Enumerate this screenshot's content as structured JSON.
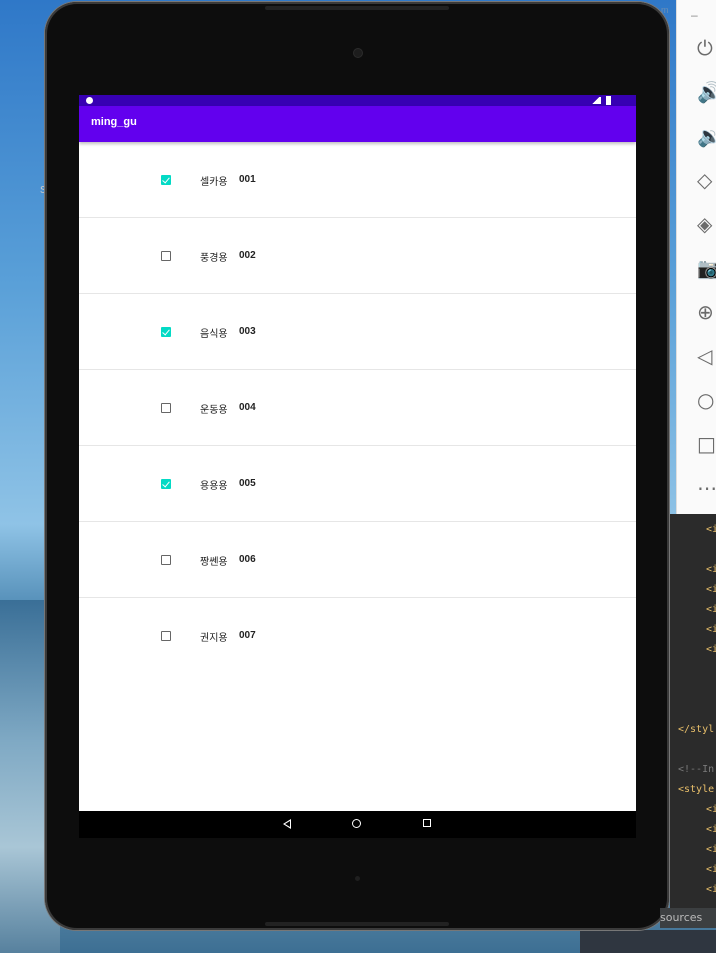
{
  "app": {
    "title": "ming_gu"
  },
  "items": [
    {
      "name": "셀카용",
      "number": "001",
      "checked": true
    },
    {
      "name": "풍경용",
      "number": "002",
      "checked": false
    },
    {
      "name": "음식용",
      "number": "003",
      "checked": true
    },
    {
      "name": "운동용",
      "number": "004",
      "checked": false
    },
    {
      "name": "용용용",
      "number": "005",
      "checked": true
    },
    {
      "name": "짱쎈용",
      "number": "006",
      "checked": false
    },
    {
      "name": "권지용",
      "number": "007",
      "checked": false
    }
  ],
  "emulator_toolbar": {
    "minimize_label": "–",
    "tools": [
      "power-icon",
      "volume-up-icon",
      "volume-down-icon",
      "rotate-left-icon",
      "rotate-right-icon",
      "camera-icon",
      "zoom-icon",
      "back-icon",
      "home-icon",
      "overview-icon",
      "more-icon"
    ]
  },
  "editor": {
    "lines": [
      "<i",
      "<i",
      "<i",
      "<i",
      "<i",
      "<i",
      "</styl",
      "<!--In",
      "<style",
      "<i",
      "<i",
      "<i",
      "<i",
      "<i"
    ],
    "tab_label": "sources"
  },
  "background": {
    "left_letter": "S",
    "top_fragment": "m"
  },
  "colors": {
    "status_bar": "#3700b3",
    "app_bar": "#6200ee",
    "checkbox_accent": "#03dac5"
  }
}
